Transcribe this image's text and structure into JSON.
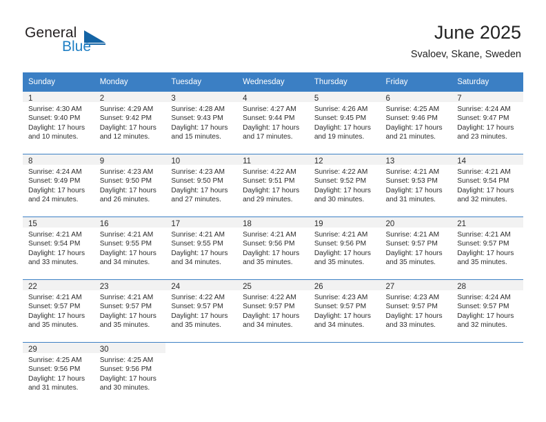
{
  "brand": {
    "name_part1": "General",
    "name_part2": "Blue",
    "logo_icon": "triangle-flag-icon"
  },
  "header": {
    "title": "June 2025",
    "subtitle": "Svaloev, Skane, Sweden"
  },
  "calendar": {
    "weekday_headers": [
      "Sunday",
      "Monday",
      "Tuesday",
      "Wednesday",
      "Thursday",
      "Friday",
      "Saturday"
    ],
    "header_bg": "#3b7fc4",
    "daynum_bg": "#f2f2f2",
    "weeks": [
      [
        {
          "day": "1",
          "sunrise": "Sunrise: 4:30 AM",
          "sunset": "Sunset: 9:40 PM",
          "daylight": "Daylight: 17 hours and 10 minutes."
        },
        {
          "day": "2",
          "sunrise": "Sunrise: 4:29 AM",
          "sunset": "Sunset: 9:42 PM",
          "daylight": "Daylight: 17 hours and 12 minutes."
        },
        {
          "day": "3",
          "sunrise": "Sunrise: 4:28 AM",
          "sunset": "Sunset: 9:43 PM",
          "daylight": "Daylight: 17 hours and 15 minutes."
        },
        {
          "day": "4",
          "sunrise": "Sunrise: 4:27 AM",
          "sunset": "Sunset: 9:44 PM",
          "daylight": "Daylight: 17 hours and 17 minutes."
        },
        {
          "day": "5",
          "sunrise": "Sunrise: 4:26 AM",
          "sunset": "Sunset: 9:45 PM",
          "daylight": "Daylight: 17 hours and 19 minutes."
        },
        {
          "day": "6",
          "sunrise": "Sunrise: 4:25 AM",
          "sunset": "Sunset: 9:46 PM",
          "daylight": "Daylight: 17 hours and 21 minutes."
        },
        {
          "day": "7",
          "sunrise": "Sunrise: 4:24 AM",
          "sunset": "Sunset: 9:47 PM",
          "daylight": "Daylight: 17 hours and 23 minutes."
        }
      ],
      [
        {
          "day": "8",
          "sunrise": "Sunrise: 4:24 AM",
          "sunset": "Sunset: 9:49 PM",
          "daylight": "Daylight: 17 hours and 24 minutes."
        },
        {
          "day": "9",
          "sunrise": "Sunrise: 4:23 AM",
          "sunset": "Sunset: 9:50 PM",
          "daylight": "Daylight: 17 hours and 26 minutes."
        },
        {
          "day": "10",
          "sunrise": "Sunrise: 4:23 AM",
          "sunset": "Sunset: 9:50 PM",
          "daylight": "Daylight: 17 hours and 27 minutes."
        },
        {
          "day": "11",
          "sunrise": "Sunrise: 4:22 AM",
          "sunset": "Sunset: 9:51 PM",
          "daylight": "Daylight: 17 hours and 29 minutes."
        },
        {
          "day": "12",
          "sunrise": "Sunrise: 4:22 AM",
          "sunset": "Sunset: 9:52 PM",
          "daylight": "Daylight: 17 hours and 30 minutes."
        },
        {
          "day": "13",
          "sunrise": "Sunrise: 4:21 AM",
          "sunset": "Sunset: 9:53 PM",
          "daylight": "Daylight: 17 hours and 31 minutes."
        },
        {
          "day": "14",
          "sunrise": "Sunrise: 4:21 AM",
          "sunset": "Sunset: 9:54 PM",
          "daylight": "Daylight: 17 hours and 32 minutes."
        }
      ],
      [
        {
          "day": "15",
          "sunrise": "Sunrise: 4:21 AM",
          "sunset": "Sunset: 9:54 PM",
          "daylight": "Daylight: 17 hours and 33 minutes."
        },
        {
          "day": "16",
          "sunrise": "Sunrise: 4:21 AM",
          "sunset": "Sunset: 9:55 PM",
          "daylight": "Daylight: 17 hours and 34 minutes."
        },
        {
          "day": "17",
          "sunrise": "Sunrise: 4:21 AM",
          "sunset": "Sunset: 9:55 PM",
          "daylight": "Daylight: 17 hours and 34 minutes."
        },
        {
          "day": "18",
          "sunrise": "Sunrise: 4:21 AM",
          "sunset": "Sunset: 9:56 PM",
          "daylight": "Daylight: 17 hours and 35 minutes."
        },
        {
          "day": "19",
          "sunrise": "Sunrise: 4:21 AM",
          "sunset": "Sunset: 9:56 PM",
          "daylight": "Daylight: 17 hours and 35 minutes."
        },
        {
          "day": "20",
          "sunrise": "Sunrise: 4:21 AM",
          "sunset": "Sunset: 9:57 PM",
          "daylight": "Daylight: 17 hours and 35 minutes."
        },
        {
          "day": "21",
          "sunrise": "Sunrise: 4:21 AM",
          "sunset": "Sunset: 9:57 PM",
          "daylight": "Daylight: 17 hours and 35 minutes."
        }
      ],
      [
        {
          "day": "22",
          "sunrise": "Sunrise: 4:21 AM",
          "sunset": "Sunset: 9:57 PM",
          "daylight": "Daylight: 17 hours and 35 minutes."
        },
        {
          "day": "23",
          "sunrise": "Sunrise: 4:21 AM",
          "sunset": "Sunset: 9:57 PM",
          "daylight": "Daylight: 17 hours and 35 minutes."
        },
        {
          "day": "24",
          "sunrise": "Sunrise: 4:22 AM",
          "sunset": "Sunset: 9:57 PM",
          "daylight": "Daylight: 17 hours and 35 minutes."
        },
        {
          "day": "25",
          "sunrise": "Sunrise: 4:22 AM",
          "sunset": "Sunset: 9:57 PM",
          "daylight": "Daylight: 17 hours and 34 minutes."
        },
        {
          "day": "26",
          "sunrise": "Sunrise: 4:23 AM",
          "sunset": "Sunset: 9:57 PM",
          "daylight": "Daylight: 17 hours and 34 minutes."
        },
        {
          "day": "27",
          "sunrise": "Sunrise: 4:23 AM",
          "sunset": "Sunset: 9:57 PM",
          "daylight": "Daylight: 17 hours and 33 minutes."
        },
        {
          "day": "28",
          "sunrise": "Sunrise: 4:24 AM",
          "sunset": "Sunset: 9:57 PM",
          "daylight": "Daylight: 17 hours and 32 minutes."
        }
      ],
      [
        {
          "day": "29",
          "sunrise": "Sunrise: 4:25 AM",
          "sunset": "Sunset: 9:56 PM",
          "daylight": "Daylight: 17 hours and 31 minutes."
        },
        {
          "day": "30",
          "sunrise": "Sunrise: 4:25 AM",
          "sunset": "Sunset: 9:56 PM",
          "daylight": "Daylight: 17 hours and 30 minutes."
        },
        {
          "day": "",
          "sunrise": "",
          "sunset": "",
          "daylight": ""
        },
        {
          "day": "",
          "sunrise": "",
          "sunset": "",
          "daylight": ""
        },
        {
          "day": "",
          "sunrise": "",
          "sunset": "",
          "daylight": ""
        },
        {
          "day": "",
          "sunrise": "",
          "sunset": "",
          "daylight": ""
        },
        {
          "day": "",
          "sunrise": "",
          "sunset": "",
          "daylight": ""
        }
      ]
    ]
  }
}
